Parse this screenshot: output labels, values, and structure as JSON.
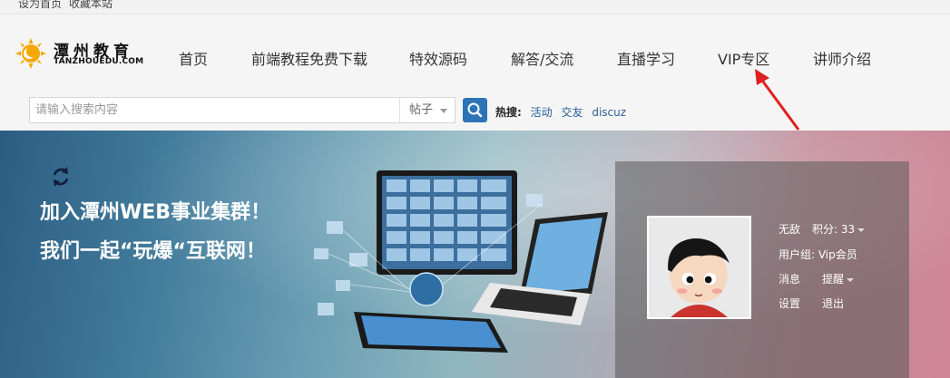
{
  "topbar": {
    "set_home": "设为首页",
    "bookmark": "收藏本站"
  },
  "logo": {
    "cn": "潭州教育",
    "en": "TANZHOUEDU.COM"
  },
  "nav": [
    "首页",
    "前端教程免费下载",
    "特效源码",
    "解答/交流",
    "直播学习",
    "VIP专区",
    "讲师介绍"
  ],
  "search": {
    "placeholder": "请输入搜索内容",
    "value": "",
    "type_selected": "帖子",
    "hot_label": "热搜:",
    "hot_links": [
      "活动",
      "交友",
      "discuz"
    ]
  },
  "banner": {
    "line1": "加入潭州WEB事业集群！",
    "line2": "我们一起“玩爆“互联网！"
  },
  "user": {
    "name": "无敌",
    "points_label": "积分: 33",
    "group": "用户组: Vip会员",
    "messages": "消息",
    "reminders": "提醒",
    "settings": "设置",
    "logout": "退出"
  },
  "colors": {
    "accent_blue": "#2d74b6",
    "arrow_red": "#e02020",
    "logo_yellow": "#f5a800"
  },
  "icons": {
    "search": "search-icon",
    "refresh": "refresh-icon",
    "logo": "sun-logo-icon"
  }
}
